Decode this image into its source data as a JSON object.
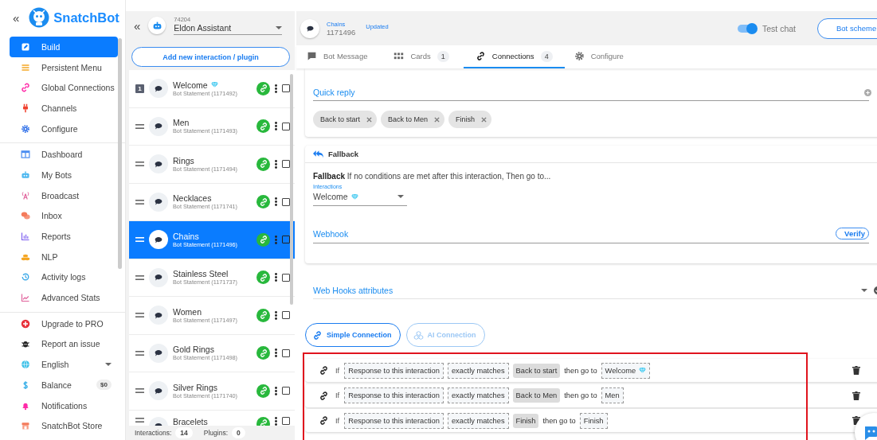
{
  "sidebar": {
    "collapse": "«",
    "logo": "SnatchBot",
    "sections": [
      [
        {
          "label": "Build",
          "selected": true
        },
        {
          "label": "Persistent Menu",
          "selected": false
        },
        {
          "label": "Global Connections",
          "selected": false
        },
        {
          "label": "Channels",
          "selected": false
        },
        {
          "label": "Configure",
          "selected": false
        }
      ],
      [
        {
          "label": "Dashboard",
          "selected": false
        },
        {
          "label": "My Bots",
          "selected": false
        },
        {
          "label": "Broadcast",
          "selected": false
        },
        {
          "label": "Inbox",
          "selected": false
        },
        {
          "label": "Reports",
          "selected": false
        },
        {
          "label": "NLP",
          "selected": false
        },
        {
          "label": "Activity logs",
          "selected": false
        },
        {
          "label": "Advanced Stats",
          "selected": false
        }
      ],
      [
        {
          "label": "Upgrade to PRO",
          "selected": false
        },
        {
          "label": "Report an issue",
          "selected": false
        },
        {
          "label": "English",
          "selected": false,
          "dropdown": true
        },
        {
          "label": "Balance",
          "selected": false,
          "badge": "$0"
        },
        {
          "label": "Notifications",
          "selected": false
        },
        {
          "label": "SnatchBot Store",
          "selected": false
        }
      ]
    ]
  },
  "bot_panel": {
    "collapse": "«",
    "bot_id": "74204",
    "bot_name": "Eldon Assistant",
    "add_button": "Add new interaction / plugin",
    "interactions": [
      {
        "number": "1",
        "title": "Welcome",
        "gem": true,
        "subtitle": "Bot Statement (1171492)",
        "selected": false
      },
      {
        "title": "Men",
        "gem": false,
        "subtitle": "Bot Statement (1171493)",
        "selected": false
      },
      {
        "title": "Rings",
        "gem": false,
        "subtitle": "Bot Statement (1171494)",
        "selected": false
      },
      {
        "title": "Necklaces",
        "gem": false,
        "subtitle": "Bot Statement (1171741)",
        "selected": false
      },
      {
        "title": "Chains",
        "gem": false,
        "subtitle": "Bot Statement (1171496)",
        "selected": true
      },
      {
        "title": "Stainless Steel",
        "gem": false,
        "subtitle": "Bot Statement (1171737)",
        "selected": false
      },
      {
        "title": "Women",
        "gem": false,
        "subtitle": "Bot Statement (1171497)",
        "selected": false
      },
      {
        "title": "Gold Rings",
        "gem": false,
        "subtitle": "Bot Statement (1171498)",
        "selected": false
      },
      {
        "title": "Silver Rings",
        "gem": false,
        "subtitle": "Bot Statement (1171740)",
        "selected": false
      },
      {
        "title": "Bracelets",
        "gem": false,
        "selected": false
      }
    ],
    "footer": {
      "interactions_label": "Interactions:",
      "interactions_count": "14",
      "plugins_label": "Plugins:",
      "plugins_count": "0"
    }
  },
  "header": {
    "interaction_name": "Chains",
    "interaction_id": "1171496",
    "status": "Updated",
    "test_chat": {
      "label": "Test chat",
      "on": true
    },
    "scheme_button": "Bot scheme"
  },
  "tabs": [
    {
      "label": "Bot Message",
      "selected": false
    },
    {
      "label": "Cards",
      "count": "1",
      "selected": false
    },
    {
      "label": "Connections",
      "count": "4",
      "selected": true
    },
    {
      "label": "Configure",
      "selected": false
    }
  ],
  "quick_reply": {
    "label": "Quick reply",
    "chips": [
      "Back to start",
      "Back to Men",
      "Finish"
    ]
  },
  "fallback": {
    "title": "Fallback",
    "sentence": "**Fallback** If no conditions are met after this interaction, Then go to...",
    "select_label": "Interactions",
    "select_value": "Welcome",
    "select_gem": true,
    "webhook_label": "Webhook",
    "verify_button": "Verify"
  },
  "webhook_attributes": {
    "label": "Web Hooks attributes"
  },
  "connection_types": [
    {
      "label": "Simple Connection",
      "selected": true
    },
    {
      "label": "AI Connection",
      "selected": false
    }
  ],
  "connections": [
    {
      "if": "If",
      "source": "Response to this interaction",
      "operator": "exactly matches",
      "value": "Back to start",
      "then": "then go to",
      "target": "Welcome",
      "gem": true
    },
    {
      "if": "If",
      "source": "Response to this interaction",
      "operator": "exactly matches",
      "value": "Back to Men",
      "then": "then go to",
      "target": "Men",
      "gem": false
    },
    {
      "if": "If",
      "source": "Response to this interaction",
      "operator": "exactly matches",
      "value": "Finish",
      "then": "then go to",
      "target": "Finish",
      "gem": false
    }
  ]
}
